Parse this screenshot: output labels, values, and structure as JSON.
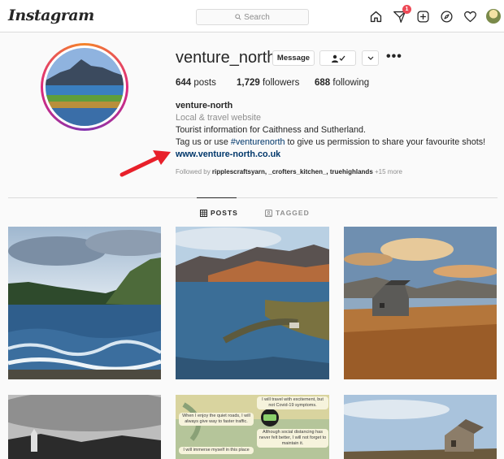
{
  "nav": {
    "logo": "Instagram",
    "search_placeholder": "Search",
    "notification_count": "1"
  },
  "profile": {
    "username": "venture_north",
    "message_label": "Message",
    "stats": {
      "posts_count": "644",
      "posts_label": "posts",
      "followers_count": "1,729",
      "followers_label": "followers",
      "following_count": "688",
      "following_label": "following"
    },
    "bio": {
      "name": "venture-north",
      "category": "Local & travel website",
      "line1": "Tourist information for Caithness and Sutherland.",
      "line2_before": "Tag us or use ",
      "hashtag": "#venturenorth",
      "line2_after": " to give us permission to share your favourite shots!",
      "website": "www.venture-north.co.uk"
    },
    "followed_by": {
      "prefix": "Followed by ",
      "names": "ripplescraftsyarn, _crofters_kitchen_, truehighlands",
      "suffix": " +15 more"
    }
  },
  "tabs": {
    "posts": "POSTS",
    "tagged": "TAGGED"
  },
  "posts_preview_text": {
    "bubble1": "I will travel with excitement, but not Covid-19 symptoms.",
    "bubble2": "When I enjoy the quiet roads, I will always give way to faster traffic.",
    "bubble3": "Although social distancing has never felt better, I will not forget to maintain it.",
    "bubble4": "I will immerse myself in this place"
  },
  "colors": {
    "link": "#00376b",
    "badge": "#ed4956",
    "arrow": "#e8202a"
  }
}
